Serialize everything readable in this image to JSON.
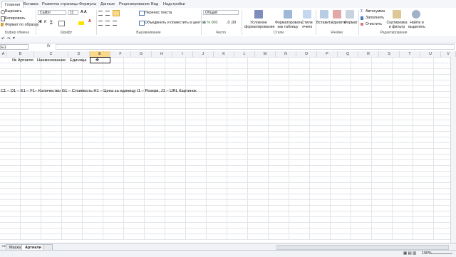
{
  "ribbon_tabs": [
    "Главная",
    "Вставка",
    "Разметка страницы",
    "Формулы",
    "Данные",
    "Рецензирование",
    "Вид",
    "Надстройки"
  ],
  "clipboard": {
    "cut": "Вырезать",
    "copy": "Копировать",
    "format_painter": "Формат по образцу",
    "label": "Буфер обмена"
  },
  "font": {
    "name": "Calibri",
    "size": "11",
    "label": "Шрифт"
  },
  "alignment": {
    "wrap": "Перенос текста",
    "merge": "Объединить и поместить в центре",
    "label": "Выравнивание"
  },
  "number": {
    "format": "Общий",
    "label": "Число"
  },
  "styles": {
    "conditional": "Условное форматирование",
    "as_table": "Форматировать как таблицу",
    "cell_styles": "Стили ячеек",
    "label": "Стили"
  },
  "cells": {
    "insert": "Вставить",
    "delete": "Удалить",
    "format": "Формат",
    "label": "Ячейки"
  },
  "editing": {
    "autosum": "Автосумма",
    "fill": "Заполнить",
    "clear": "Очистить",
    "sort": "Сортировка и фильтр",
    "find": "Найти и выделить",
    "label": "Редактирование"
  },
  "name_box": "E1",
  "fx": "fx",
  "columns": [
    "A",
    "B",
    "C",
    "D",
    "E",
    "F",
    "G",
    "H",
    "I",
    "J",
    "K",
    "L",
    "M",
    "N",
    "O",
    "P",
    "Q",
    "R",
    "S",
    "T",
    "U",
    "V"
  ],
  "selected_column": "E",
  "cells_data": {
    "b1": "№ Артикля",
    "c1": "Наименование",
    "d1": "Единица",
    "row8": "C1 – D1 – E1 – F1– Количество G1 – Стоимость H1 – Цена за единицу I1 – Резерв, J1 – URL Картинок"
  },
  "sheet_tabs": [
    "Маска",
    "Артикли"
  ],
  "active_sheet": "Артикли",
  "zoom": "100%",
  "colors": {
    "accent": "#1f5fa8",
    "selected": "#f9d88a"
  }
}
